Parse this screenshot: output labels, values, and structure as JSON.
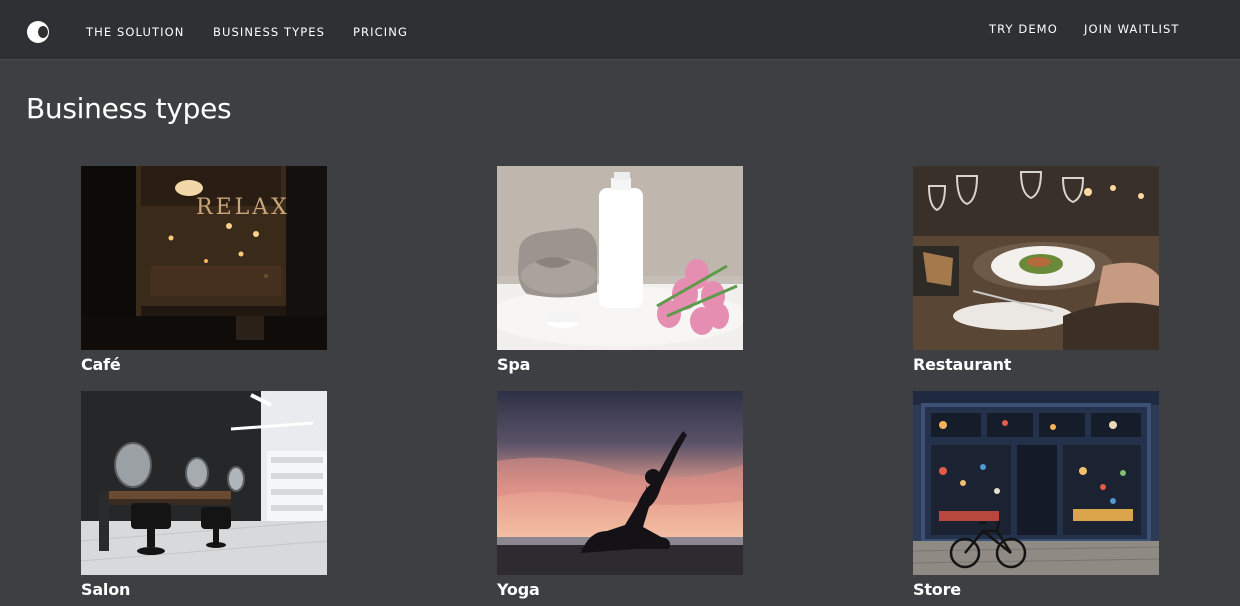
{
  "nav": {
    "logo": "logo-icon",
    "links": {
      "solution": "THE SOLUTION",
      "business_types": "BUSINESS TYPES",
      "pricing": "PRICING",
      "try_demo": "TRY DEMO",
      "join_waitlist": "JOIN WAITLIST"
    }
  },
  "page": {
    "title": "Business types"
  },
  "business_types": [
    {
      "label": "Café",
      "image": "cafe-photo"
    },
    {
      "label": "Spa",
      "image": "spa-photo"
    },
    {
      "label": "Restaurant",
      "image": "restaurant-photo"
    },
    {
      "label": "Salon",
      "image": "salon-photo"
    },
    {
      "label": "Yoga",
      "image": "yoga-photo"
    },
    {
      "label": "Store",
      "image": "store-photo"
    }
  ],
  "colors": {
    "background": "#3e3f43",
    "topbar": "#2f3033",
    "text": "#ffffff"
  }
}
